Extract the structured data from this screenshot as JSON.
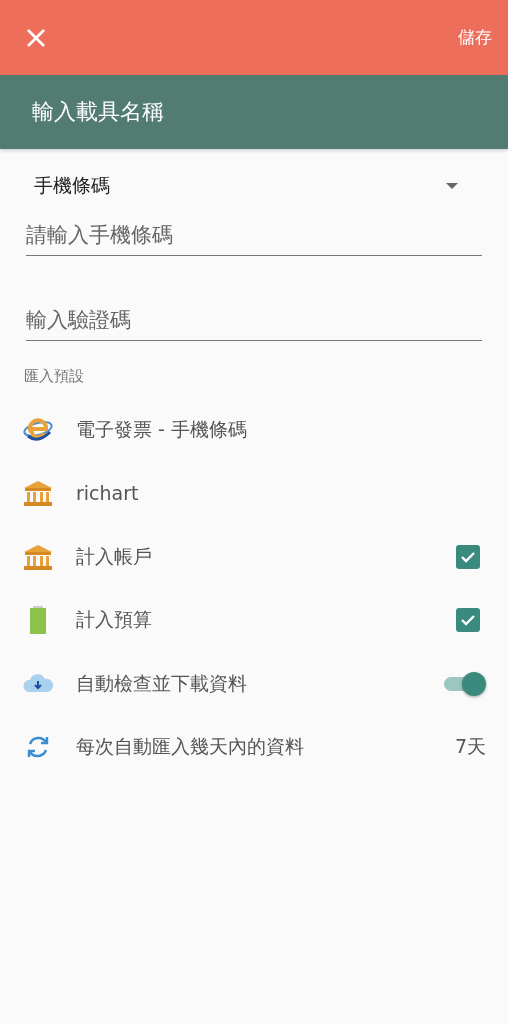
{
  "toolbar": {
    "save": "儲存"
  },
  "header": {
    "title": "輸入載具名稱"
  },
  "carrier_type": {
    "value": "手機條碼"
  },
  "fields": [
    {
      "placeholder": "請輸入手機條碼"
    },
    {
      "placeholder": "輸入驗證碼"
    }
  ],
  "section": {
    "label": "匯入預設"
  },
  "rows": [
    {
      "kind": "plain",
      "label": "電子發票 - 手機條碼"
    },
    {
      "kind": "plain",
      "label": "richart"
    },
    {
      "kind": "checkbox",
      "label": "計入帳戶",
      "checked": true
    },
    {
      "kind": "checkbox",
      "label": "計入預算",
      "checked": true
    },
    {
      "kind": "switch",
      "label": "自動檢查並下載資料",
      "on": true
    },
    {
      "kind": "value",
      "label": "每次自動匯入幾天內的資料",
      "value": "7天"
    }
  ]
}
